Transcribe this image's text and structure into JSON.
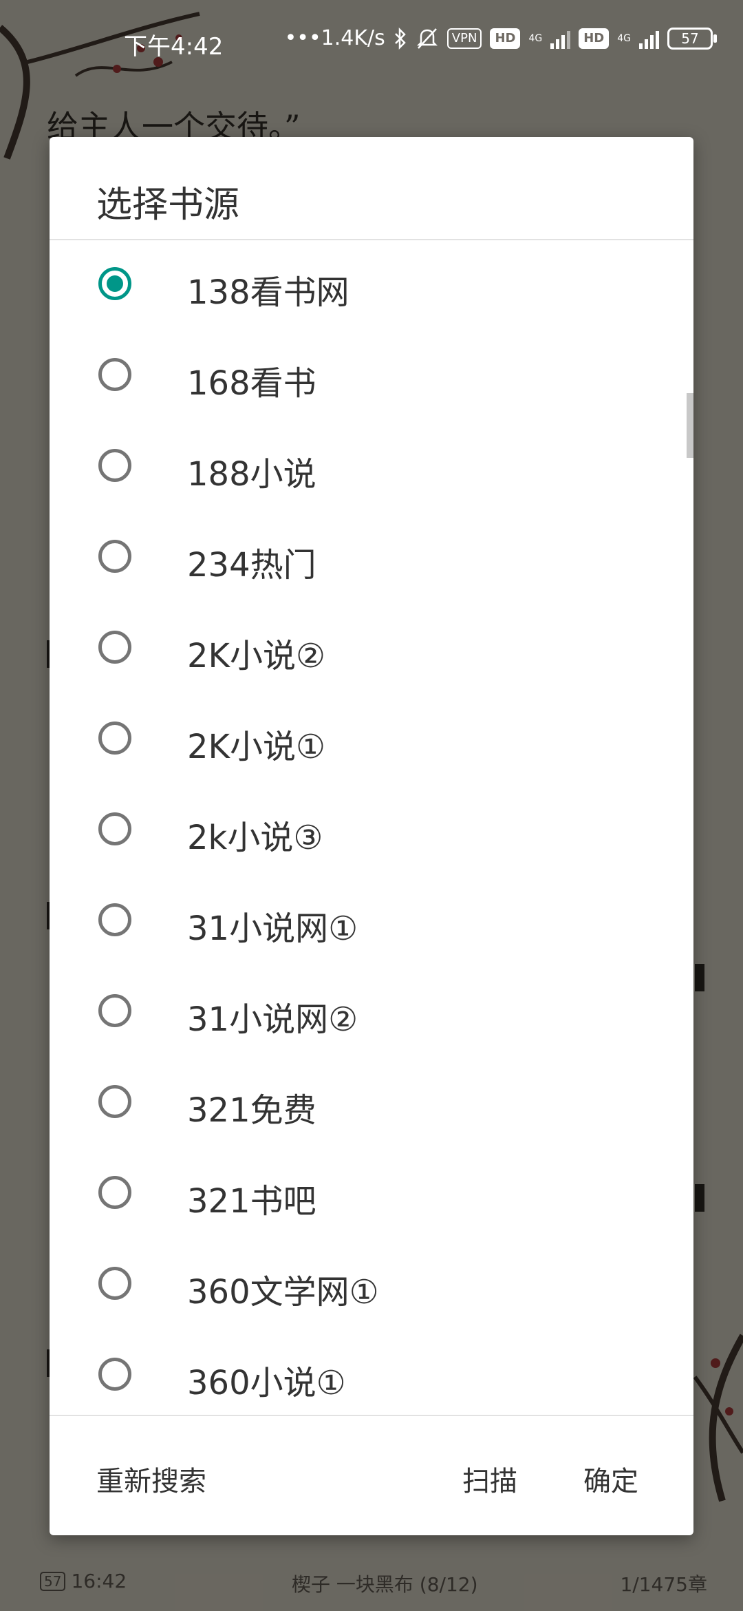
{
  "status_bar": {
    "time": "下午4:42",
    "net_speed": "1.4K/s",
    "vpn": "VPN",
    "hd1": "HD",
    "hd2": "HD",
    "net1": "4G",
    "net2": "4G",
    "battery": "57",
    "icons": [
      "bluetooth-icon",
      "mute-icon",
      "signal-icon",
      "battery-icon"
    ]
  },
  "reader": {
    "text_line": "给主人一个交待。”",
    "footer": {
      "battery": "57",
      "time": "16:42",
      "chapter": "楔子 一块黑布 (8/12)",
      "progress": "1/1475章"
    }
  },
  "dialog": {
    "title": "选择书源",
    "selected_index": 0,
    "items": [
      {
        "label": "138看书网"
      },
      {
        "label": "168看书"
      },
      {
        "label": "188小说"
      },
      {
        "label": "234热门"
      },
      {
        "label": "2K小说②"
      },
      {
        "label": "2K小说①"
      },
      {
        "label": "2k小说③"
      },
      {
        "label": "31小说网①"
      },
      {
        "label": "31小说网②"
      },
      {
        "label": "321免费"
      },
      {
        "label": "321书吧"
      },
      {
        "label": "360文学网①"
      },
      {
        "label": "360小说①"
      }
    ],
    "buttons": {
      "research": "重新搜索",
      "scan": "扫描",
      "ok": "确定"
    },
    "accent_color": "#009688"
  }
}
